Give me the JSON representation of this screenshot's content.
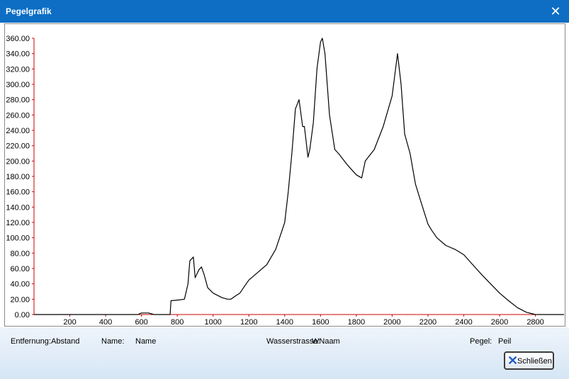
{
  "window": {
    "title": "Pegelgrafik",
    "close_symbol": "✕"
  },
  "footer": {
    "entfernung_label": "Entfernung:",
    "entfernung_value": "Abstand",
    "name_label": "Name:",
    "name_value": "Name",
    "wasserstrasse_label": "Wasserstrasse:",
    "wasserstrasse_value": "WNaam",
    "pegel_label": "Pegel:",
    "pegel_value": "Peil",
    "close_button": "Schließen"
  },
  "colors": {
    "titlebar": "#0d6ec4",
    "axis": "#cc0000",
    "line": "#000000",
    "button_icon": "#1e60c9"
  },
  "chart_data": {
    "type": "line",
    "xlim": [
      0,
      2960
    ],
    "ylim": [
      0,
      360
    ],
    "x_ticks": [
      200,
      400,
      600,
      800,
      1000,
      1200,
      1400,
      1600,
      1800,
      2000,
      2200,
      2400,
      2600,
      2800
    ],
    "y_ticks": [
      "0.00",
      "20.00",
      "40.00",
      "60.00",
      "80.00",
      "100.00",
      "120.00",
      "140.00",
      "160.00",
      "180.00",
      "200.00",
      "220.00",
      "240.00",
      "260.00",
      "280.00",
      "300.00",
      "320.00",
      "340.00",
      "360.00"
    ],
    "grid": false,
    "series": [
      {
        "x": [
          0,
          200,
          400,
          580,
          600,
          640,
          670,
          700,
          760,
          765,
          810,
          840,
          860,
          870,
          890,
          900,
          920,
          935,
          950,
          970,
          1000,
          1050,
          1080,
          1100,
          1130,
          1150,
          1170,
          1200,
          1250,
          1300,
          1350,
          1400,
          1420,
          1440,
          1460,
          1480,
          1500,
          1510,
          1530,
          1540,
          1560,
          1580,
          1600,
          1610,
          1625,
          1650,
          1680,
          1700,
          1750,
          1800,
          1830,
          1850,
          1900,
          1950,
          2000,
          2030,
          2050,
          2070,
          2100,
          2130,
          2150,
          2170,
          2200,
          2220,
          2250,
          2300,
          2350,
          2400,
          2450,
          2500,
          2550,
          2600,
          2650,
          2700,
          2750,
          2800,
          2850,
          2900,
          2960
        ],
        "y": [
          0,
          0,
          0,
          0,
          2,
          2,
          0,
          0,
          0,
          18,
          19,
          20,
          40,
          70,
          75,
          48,
          58,
          62,
          52,
          35,
          28,
          22,
          20,
          20,
          25,
          28,
          35,
          45,
          55,
          65,
          85,
          120,
          160,
          210,
          268,
          280,
          245,
          245,
          205,
          215,
          250,
          320,
          355,
          360,
          340,
          260,
          215,
          210,
          195,
          182,
          178,
          200,
          215,
          245,
          285,
          340,
          300,
          235,
          210,
          170,
          155,
          140,
          118,
          110,
          100,
          90,
          85,
          78,
          65,
          52,
          40,
          28,
          18,
          9,
          3,
          0,
          0,
          0,
          0
        ]
      }
    ]
  }
}
